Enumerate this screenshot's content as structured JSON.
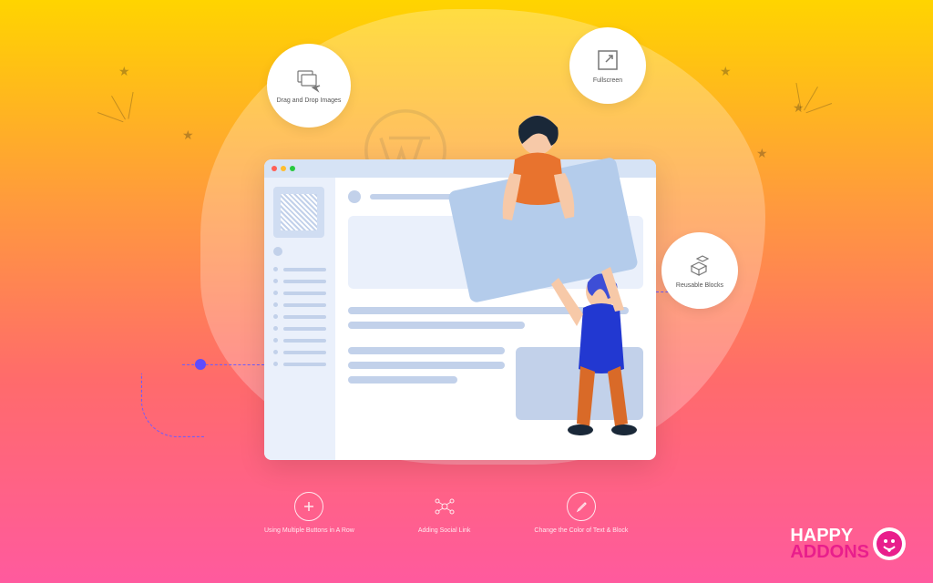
{
  "circles": {
    "drag": {
      "label": "Drag and Drop\nImages"
    },
    "fullscreen": {
      "label": "Fullscreen"
    },
    "reusable": {
      "label": "Reusable Blocks"
    }
  },
  "bottom": {
    "buttons": {
      "label": "Using Multiple\nButtons in A Row"
    },
    "social": {
      "label": "Adding\nSocial Link"
    },
    "color": {
      "label": "Change the Color\nof Text & Block"
    }
  },
  "logo": {
    "line1": "HAPPY",
    "line2": "ADDONS"
  }
}
